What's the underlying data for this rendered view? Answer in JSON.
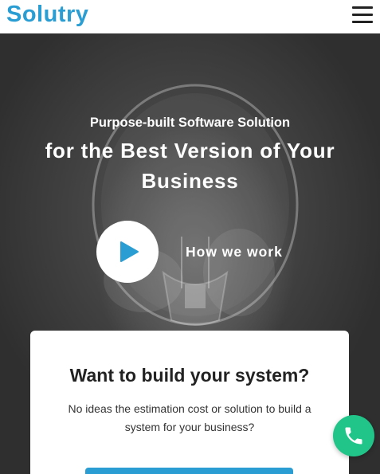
{
  "header": {
    "logo": "Solutry",
    "menu_icon": "hamburger-menu-icon"
  },
  "hero": {
    "subtitle": "Purpose-built Software Solution",
    "title": "for the Best Version of Your Business",
    "play_icon": "play-icon",
    "video_label": "How we work"
  },
  "card": {
    "title": "Want to build your system?",
    "description": "No ideas the estimation cost or solution to build a system for your business?"
  },
  "floating": {
    "call_icon": "phone-icon"
  },
  "colors": {
    "brand": "#2a9ed3",
    "call": "#21c58a",
    "play": "#2a9ed3"
  }
}
